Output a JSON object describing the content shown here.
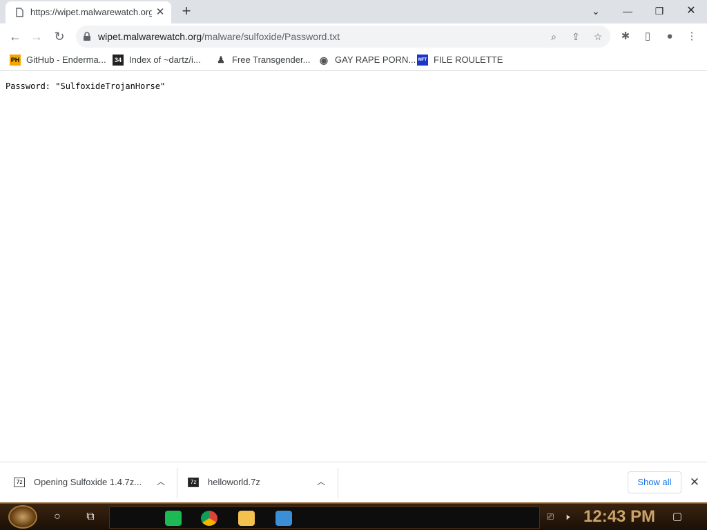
{
  "browser": {
    "tab": {
      "title": "https://wipet.malwarewatch.org/malware/sulfoxide/Password.txt",
      "favicon": "page-icon"
    },
    "window_controls": {
      "dropdown": "chevron-down-icon",
      "minimize": "minimize-icon",
      "restore": "restore-icon",
      "close": "close-icon"
    },
    "url": {
      "host": "wipet.malwarewatch.org",
      "path": "/malware/sulfoxide/Password.txt"
    },
    "bookmarks": [
      {
        "label": "GitHub - Enderma...",
        "icon_text": "PH",
        "color": "#f4a700"
      },
      {
        "label": "Index of ~dartz/i...",
        "icon_text": "34",
        "color": "#222222"
      },
      {
        "label": "Free Transgender...",
        "icon_text": "",
        "color": "#444444"
      },
      {
        "label": "GAY RAPE PORN...",
        "icon_text": "",
        "color": "#555555"
      },
      {
        "label": "FILE ROULETTE",
        "icon_text": "MFT",
        "color": "#1a37c8"
      }
    ]
  },
  "content": {
    "text": "Password: \"SulfoxideTrojanHorse\""
  },
  "downloads": {
    "items": [
      {
        "name": "Opening Sulfoxide 1.4.7z...",
        "icon": "7z"
      },
      {
        "name": "helloworld.7z",
        "icon": "7z"
      }
    ],
    "show_all": "Show all"
  },
  "taskbar": {
    "clock": "12:43 PM",
    "apps": [
      {
        "name": "spotify-icon",
        "color": "#1db954"
      },
      {
        "name": "chrome-icon",
        "color": "#db4437"
      },
      {
        "name": "file-explorer-icon",
        "color": "#f2c14e"
      },
      {
        "name": "control-panel-icon",
        "color": "#3a8fd6"
      }
    ]
  }
}
